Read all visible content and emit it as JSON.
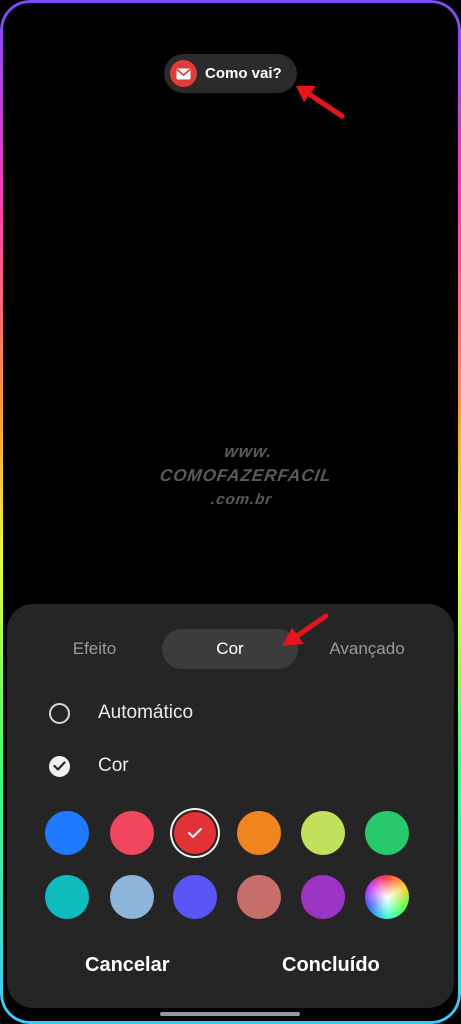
{
  "notification": {
    "text": "Como vai?",
    "icon": "mail-icon",
    "icon_color": "#e23b3b"
  },
  "watermark": {
    "line1": "www.",
    "line2": "COMOFAZERFACIL",
    "line3": ".com.br"
  },
  "tabs": [
    {
      "label": "Efeito",
      "active": false
    },
    {
      "label": "Cor",
      "active": true
    },
    {
      "label": "Avançado",
      "active": false
    }
  ],
  "options": [
    {
      "label": "Automático",
      "checked": false
    },
    {
      "label": "Cor",
      "checked": true
    }
  ],
  "colors": [
    [
      "#1e7bff",
      "#f0475f",
      "#e23238",
      "#f0841f",
      "#c3e05d",
      "#27c96a"
    ],
    [
      "#0fbcbd",
      "#8db5da",
      "#5a55f5",
      "#c56e6a",
      "#9c35c4",
      "rainbow"
    ]
  ],
  "selected_color": "#e23238",
  "buttons": {
    "cancel": "Cancelar",
    "done": "Concluído"
  }
}
